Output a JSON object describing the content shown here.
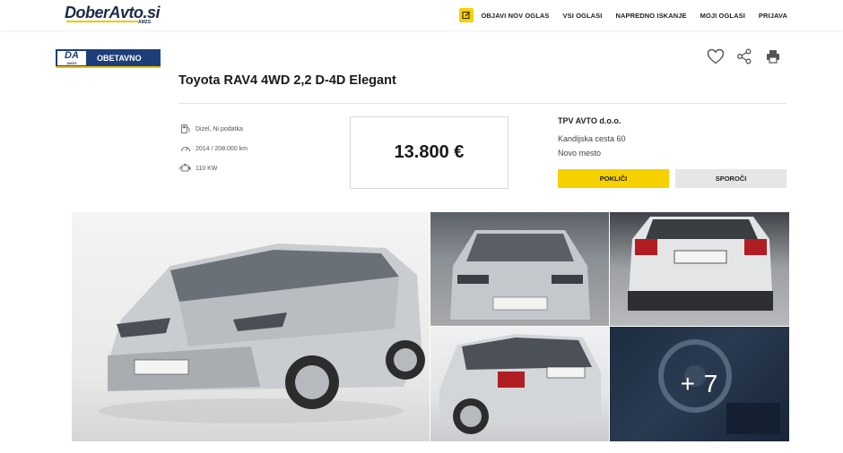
{
  "header": {
    "logo_text": "DoberAvto.si",
    "logo_sub": "AMZS",
    "nav": {
      "new_ad_icon": "edit-icon",
      "new_ad": "OBJAVI NOV OGLAS",
      "all_ads": "VSI OGLASI",
      "advanced_search": "NAPREDNO ISKANJE",
      "my_ads": "MOJI OGLASI",
      "login": "PRIJAVA"
    }
  },
  "badge": {
    "logo": "DA",
    "logo_sub": "AMZS",
    "label": "OBETAVNO"
  },
  "listing": {
    "title": "Toyota RAV4 4WD 2,2 D-4D Elegant",
    "specs": {
      "fuel": "Dizel, Ni podatka",
      "year_km": "2014 / 208.000 km",
      "power": "110 KW"
    },
    "price": "13.800 €"
  },
  "actions": {
    "favorite_icon": "heart-icon",
    "share_icon": "share-icon",
    "print_icon": "printer-icon"
  },
  "seller": {
    "name": "TPV AVTO d.o.o.",
    "address": "Kandijska cesta 60",
    "city": "Novo mesto",
    "call_label": "POKLIČI",
    "message_label": "SPOROČI"
  },
  "gallery": {
    "more_count": "+ 7"
  },
  "colors": {
    "accent_yellow": "#f7d000",
    "brand_navy": "#1d3f79"
  }
}
